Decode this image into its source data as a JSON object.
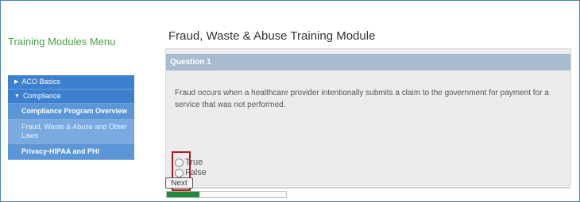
{
  "sidebar": {
    "title": "Training Modules Menu",
    "items": [
      {
        "label": "ACO Basics",
        "type": "section"
      },
      {
        "label": "Compliance",
        "type": "section"
      },
      {
        "label": "Compliance Program Overview",
        "type": "sub"
      },
      {
        "label": "Fraud, Waste & Abuse and Other Laws",
        "type": "sub",
        "active": true
      },
      {
        "label": "Privacy-HIPAA and PHI",
        "type": "sub"
      }
    ]
  },
  "main": {
    "title": "Fraud, Waste & Abuse Training Module",
    "question": {
      "label": "Question 1",
      "text": "Fraud occurs when a healthcare provider intentionally submits a claim to the government for payment for a service that was not performed.",
      "options": [
        "True",
        "False"
      ],
      "selected": null
    },
    "next_label": "Next",
    "progress": 0.27
  },
  "colors": {
    "accent": "#2c6fbf",
    "title_green": "#4aa04a",
    "question_bar": "#a9bccf",
    "progress_fill": "#1f8a3e",
    "highlight": "#b02020"
  }
}
